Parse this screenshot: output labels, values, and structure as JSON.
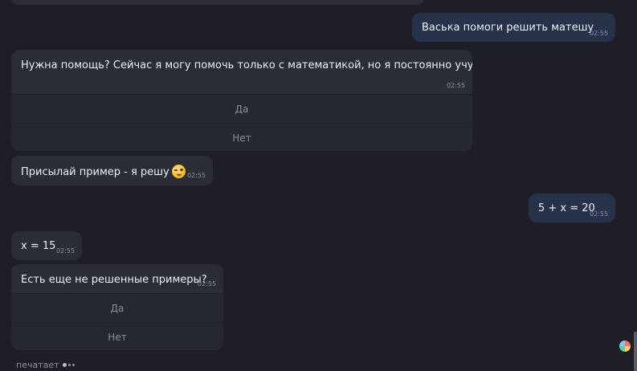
{
  "messages": [
    {
      "id": "out1",
      "text": "Васька помоги решить матешу",
      "time": "02:55"
    },
    {
      "id": "in1",
      "text": "Нужна помощь? Сейчас я могу помочь только с математикой, но я постоянно учусь:)",
      "time": "02:55",
      "buttons": [
        "Да",
        "Нет"
      ]
    },
    {
      "id": "in2",
      "text": "Присылай пример - я решу",
      "time": "02:55"
    },
    {
      "id": "out2",
      "text": "5 + x = 20",
      "time": "02:55"
    },
    {
      "id": "in3",
      "text": "x = 15",
      "time": "02:55"
    },
    {
      "id": "in4",
      "text": "Есть еще не решенные примеры?",
      "time": "02:55",
      "buttons": [
        "Да",
        "Нет"
      ]
    }
  ],
  "status": {
    "typing": "печатает"
  },
  "icons": {
    "emoji": "winking-face-icon",
    "corner": "sticker-icon"
  }
}
